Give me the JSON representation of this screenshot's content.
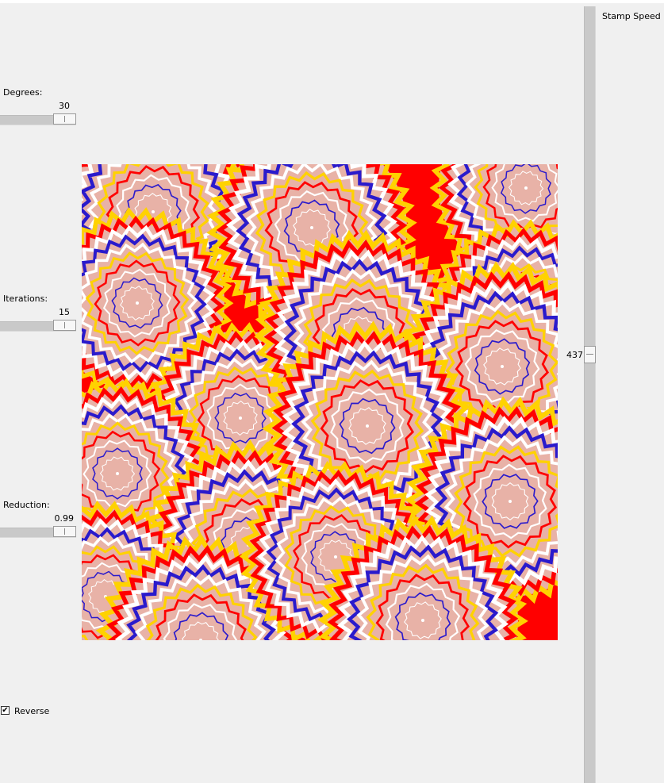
{
  "controls": {
    "degrees": {
      "label": "Degrees:",
      "value": "30"
    },
    "iterations": {
      "label": "Iterations:",
      "value": "15"
    },
    "reduction": {
      "label": "Reduction:",
      "value": "0.99"
    },
    "reverse": {
      "label": "Reverse",
      "checked": true,
      "check_glyph": "✔"
    }
  },
  "stamp_speed": {
    "label": "Stamp Speed",
    "value": "437"
  },
  "canvas": {
    "pattern": "rotating-zigzag-spirals",
    "colors": {
      "red": "#ff0000",
      "yellow": "#ffd200",
      "blue": "#2a1acc",
      "white": "#ffffff",
      "pink": "#e8b2a7"
    }
  }
}
